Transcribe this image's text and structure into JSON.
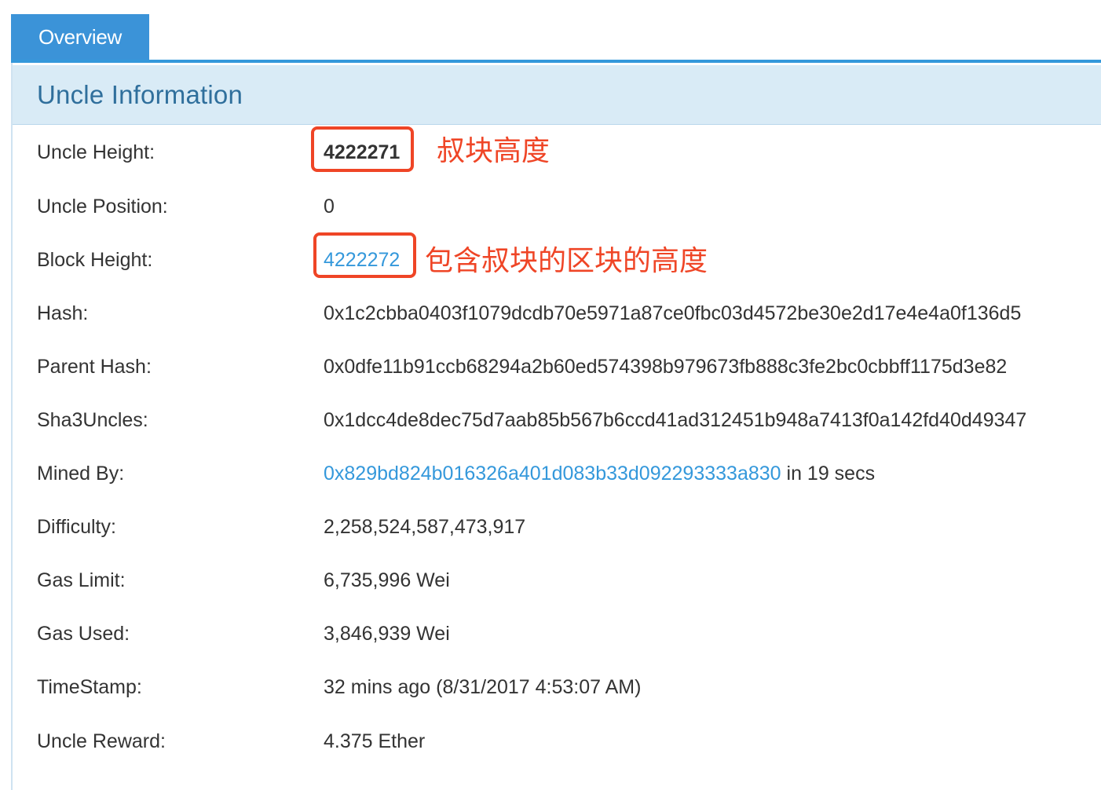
{
  "tabs": [
    {
      "label": "Overview",
      "active": true
    }
  ],
  "panel": {
    "title": "Uncle Information"
  },
  "rows": [
    {
      "label": "Uncle Height:",
      "value": "4222271"
    },
    {
      "label": "Uncle Position:",
      "value": "0"
    },
    {
      "label": "Block Height:",
      "value": "4222272"
    },
    {
      "label": "Hash:",
      "value": "0x1c2cbba0403f1079dcdb70e5971a87ce0fbc03d4572be30e2d17e4e4a0f136d5"
    },
    {
      "label": "Parent Hash:",
      "value": "0x0dfe11b91ccb68294a2b60ed574398b979673fb888c3fe2bc0cbbff1175d3e82"
    },
    {
      "label": "Sha3Uncles:",
      "value": "0x1dcc4de8dec75d7aab85b567b6ccd41ad312451b948a7413f0a142fd40d49347"
    },
    {
      "label": "Mined By:",
      "value": "0x829bd824b016326a401d083b33d092293333a830",
      "suffix": " in 19 secs"
    },
    {
      "label": "Difficulty:",
      "value": "2,258,524,587,473,917"
    },
    {
      "label": "Gas Limit:",
      "value": "6,735,996 Wei"
    },
    {
      "label": "Gas Used:",
      "value": "3,846,939 Wei"
    },
    {
      "label": "TimeStamp:",
      "value": "32 mins ago (8/31/2017 4:53:07 AM)"
    },
    {
      "label": "Uncle Reward:",
      "value": "4.375 Ether"
    }
  ],
  "annotations": {
    "uncle_height_note": "叔块高度",
    "block_height_note": "包含叔块的区块的高度"
  },
  "colors": {
    "accent": "#3b93d8",
    "heading_bg": "#d9ebf6",
    "heading_text": "#2f6f9c",
    "link": "#3498db",
    "annotation": "#ef4526"
  }
}
